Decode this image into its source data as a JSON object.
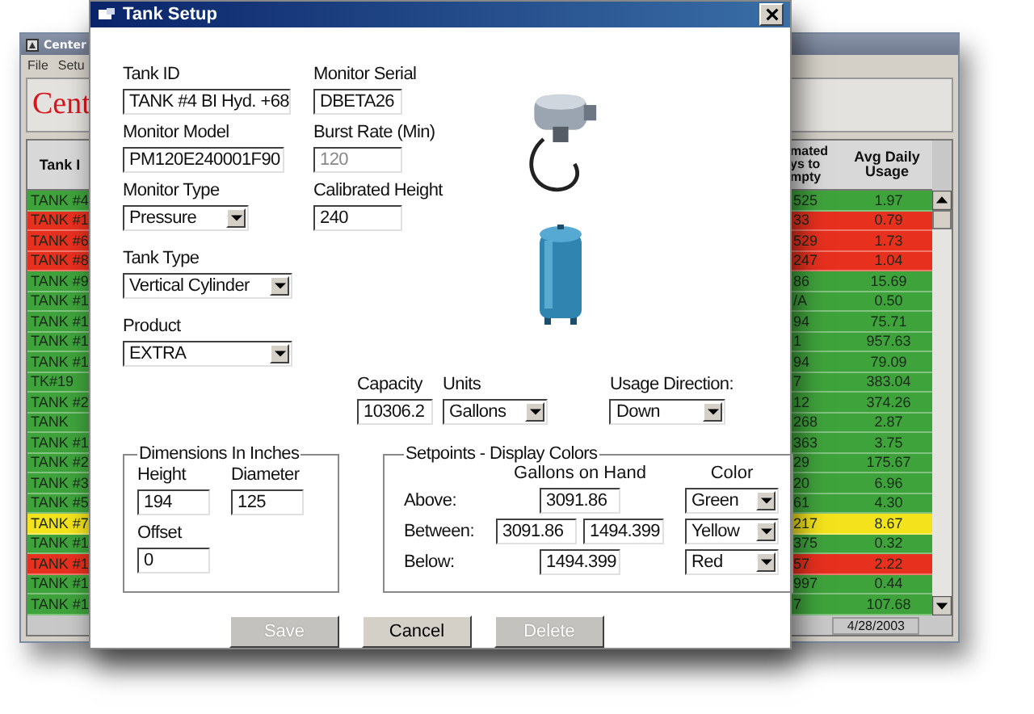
{
  "background_window": {
    "title": "Center",
    "menu": [
      "File",
      "Setu"
    ],
    "logo": "Cent",
    "table": {
      "columns": [
        "Tank I",
        "mated ys to mpty",
        "Avg Daily Usage"
      ],
      "rows": [
        {
          "column_1": "TANK #4",
          "column_3": "525",
          "avg_daily_usage": "1.97",
          "color": "#3fa33c"
        },
        {
          "column_1": "TANK #1",
          "column_3": "33",
          "avg_daily_usage": "0.79",
          "color": "#e8301f"
        },
        {
          "column_1": "TANK #6",
          "column_3": "529",
          "avg_daily_usage": "1.73",
          "color": "#e8301f"
        },
        {
          "column_1": "TANK #8",
          "column_3": "247",
          "avg_daily_usage": "1.04",
          "color": "#e8301f"
        },
        {
          "column_1": "TANK #9",
          "column_3": "86",
          "avg_daily_usage": "15.69",
          "color": "#3fa33c"
        },
        {
          "column_1": "TANK #1",
          "column_3": "/A",
          "avg_daily_usage": "0.50",
          "color": "#3fa33c"
        },
        {
          "column_1": "TANK #1",
          "column_3": "94",
          "avg_daily_usage": "75.71",
          "color": "#3fa33c"
        },
        {
          "column_1": "TANK #1",
          "column_3": "1",
          "avg_daily_usage": "957.63",
          "color": "#3fa33c"
        },
        {
          "column_1": "TANK #1",
          "column_3": "94",
          "avg_daily_usage": "79.09",
          "color": "#3fa33c"
        },
        {
          "column_1": "TK#19",
          "column_3": "7",
          "avg_daily_usage": "383.04",
          "color": "#3fa33c"
        },
        {
          "column_1": "TANK #2",
          "column_3": "12",
          "avg_daily_usage": "374.26",
          "color": "#3fa33c"
        },
        {
          "column_1": "TANK",
          "column_3": "268",
          "avg_daily_usage": "2.87",
          "color": "#3fa33c"
        },
        {
          "column_1": "TANK #1",
          "column_3": "363",
          "avg_daily_usage": "3.75",
          "color": "#3fa33c"
        },
        {
          "column_1": "TANK #2",
          "column_3": "29",
          "avg_daily_usage": "175.67",
          "color": "#3fa33c"
        },
        {
          "column_1": "TANK #3",
          "column_3": "20",
          "avg_daily_usage": "6.96",
          "color": "#3fa33c"
        },
        {
          "column_1": "TANK #5",
          "column_3": "61",
          "avg_daily_usage": "4.30",
          "color": "#3fa33c"
        },
        {
          "column_1": "TANK #7",
          "column_3": "217",
          "avg_daily_usage": "8.67",
          "color": "#f3e21c"
        },
        {
          "column_1": "TANK #1",
          "column_3": "375",
          "avg_daily_usage": "0.32",
          "color": "#3fa33c"
        },
        {
          "column_1": "TANK #1",
          "column_3": "57",
          "avg_daily_usage": "2.22",
          "color": "#e8301f"
        },
        {
          "column_1": "TANK #1",
          "column_3": "997",
          "avg_daily_usage": "0.44",
          "color": "#3fa33c"
        },
        {
          "column_1": "TANK #1",
          "column_3": "7",
          "avg_daily_usage": "107.68",
          "color": "#3fa33c"
        }
      ]
    },
    "status_bar": "4/28/2003"
  },
  "dialog": {
    "title": "Tank Setup",
    "left_fields": [
      {
        "label": "Tank ID",
        "value": "TANK #4 BI Hyd. +68",
        "kind": "text"
      },
      {
        "label": "Monitor Model",
        "value": "PM120E240001F90",
        "kind": "text"
      },
      {
        "label": "Monitor Type",
        "value": "Pressure",
        "kind": "select"
      },
      {
        "label": "Tank Type",
        "value": "Vertical Cylinder",
        "kind": "select"
      },
      {
        "label": "Product",
        "value": "EXTRA",
        "kind": "select"
      }
    ],
    "middle_fields": [
      {
        "label": "Monitor Serial",
        "value": "DBETA26",
        "disabled": false
      },
      {
        "label": "Burst Rate (Min)",
        "value": "120",
        "disabled": true
      },
      {
        "label": "Calibrated Height",
        "value": "240",
        "disabled": false
      }
    ],
    "row_fields": [
      {
        "label": "Capacity",
        "value": "10306.2",
        "kind": "text"
      },
      {
        "label": "Units",
        "value": "Gallons",
        "kind": "select"
      },
      {
        "label": "Usage Direction:",
        "value": "Down",
        "kind": "select"
      }
    ],
    "dimensions": {
      "title": "Dimensions In Inches",
      "fields": [
        {
          "label": "Height",
          "value": "194"
        },
        {
          "label": "Diameter",
          "value": "125"
        },
        {
          "label": "Offset",
          "value": "0"
        }
      ]
    },
    "setpoints": {
      "title": "Setpoints - Display Colors",
      "gallons_heading": "Gallons on Hand",
      "color_heading": "Color",
      "rows": [
        {
          "label": "Above:",
          "values": [
            "3091.86"
          ],
          "color_choice": "Green"
        },
        {
          "label": "Between:",
          "values": [
            "3091.86",
            "1494.399"
          ],
          "color_choice": "Yellow"
        },
        {
          "label": "Below:",
          "values": [
            "1494.399"
          ],
          "color_choice": "Red"
        }
      ]
    },
    "buttons": [
      {
        "label": "Save",
        "disabled": true
      },
      {
        "label": "Cancel",
        "disabled": false
      },
      {
        "label": "Delete",
        "disabled": true
      }
    ]
  }
}
